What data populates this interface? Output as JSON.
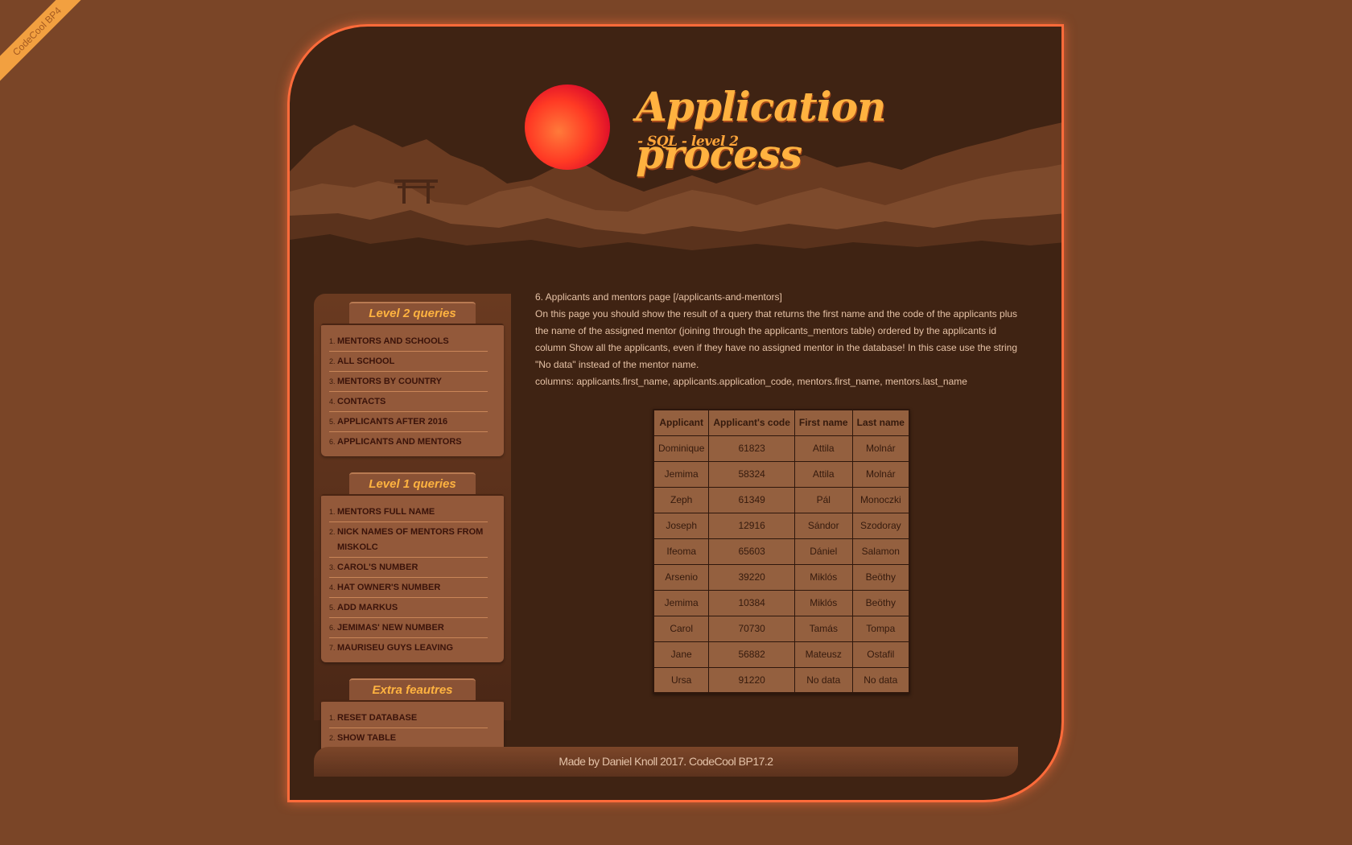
{
  "ribbon": "CodeCool BP4",
  "header": {
    "title": "Application process",
    "subtitle": "- SQL - level 2"
  },
  "sidebar": {
    "groups": [
      {
        "title": "Level 2 queries",
        "items": [
          {
            "num": "1.",
            "label": "MENTORS AND SCHOOLS"
          },
          {
            "num": "2.",
            "label": "ALL SCHOOL"
          },
          {
            "num": "3.",
            "label": "MENTORS BY COUNTRY"
          },
          {
            "num": "4.",
            "label": "CONTACTS"
          },
          {
            "num": "5.",
            "label": "APPLICANTS AFTER 2016"
          },
          {
            "num": "6.",
            "label": "APPLICANTS AND MENTORS"
          }
        ]
      },
      {
        "title": "Level 1 queries",
        "items": [
          {
            "num": "1.",
            "label": "MENTORS FULL NAME"
          },
          {
            "num": "2.",
            "label": "NICK NAMES OF MENTORS FROM MISKOLC"
          },
          {
            "num": "3.",
            "label": "CAROL'S NUMBER"
          },
          {
            "num": "4.",
            "label": "HAT OWNER'S NUMBER"
          },
          {
            "num": "5.",
            "label": "ADD MARKUS"
          },
          {
            "num": "6.",
            "label": "JEMIMAS' NEW NUMBER"
          },
          {
            "num": "7.",
            "label": "MAURISEU GUYS LEAVING"
          }
        ]
      },
      {
        "title": "Extra feautres",
        "items": [
          {
            "num": "1.",
            "label": "RESET DATABASE"
          },
          {
            "num": "2.",
            "label": "SHOW TABLE"
          }
        ]
      }
    ]
  },
  "content": {
    "heading": "6. Applicants and mentors page [/applicants-and-mentors]",
    "description": "On this page you should show the result of a query that returns the first name and the code of the applicants plus the name of the assigned mentor (joining through the applicants_mentors table) ordered by the applicants id column Show all the applicants, even if they have no assigned mentor in the database! In this case use the string \"No data\" instead of the mentor name.",
    "columns": "columns: applicants.first_name, applicants.application_code, mentors.first_name, mentors.last_name"
  },
  "table": {
    "headers": [
      "Applicant",
      "Applicant's code",
      "First name",
      "Last name"
    ],
    "rows": [
      [
        "Dominique",
        "61823",
        "Attila",
        "Molnár"
      ],
      [
        "Jemima",
        "58324",
        "Attila",
        "Molnár"
      ],
      [
        "Zeph",
        "61349",
        "Pál",
        "Monoczki"
      ],
      [
        "Joseph",
        "12916",
        "Sándor",
        "Szodoray"
      ],
      [
        "Ifeoma",
        "65603",
        "Dániel",
        "Salamon"
      ],
      [
        "Arsenio",
        "39220",
        "Miklós",
        "Beöthy"
      ],
      [
        "Jemima",
        "10384",
        "Miklós",
        "Beöthy"
      ],
      [
        "Carol",
        "70730",
        "Tamás",
        "Tompa"
      ],
      [
        "Jane",
        "56882",
        "Mateusz",
        "Ostafil"
      ],
      [
        "Ursa",
        "91220",
        "No data",
        "No data"
      ]
    ]
  },
  "footer": "Made by Daniel Knoll 2017. CodeCool BP17.2",
  "colors": {
    "background": "#7a4527",
    "frame": "#3f2313",
    "frame_border": "#ff6b3a",
    "title": "#ffb240",
    "sun": "#ff3020"
  }
}
